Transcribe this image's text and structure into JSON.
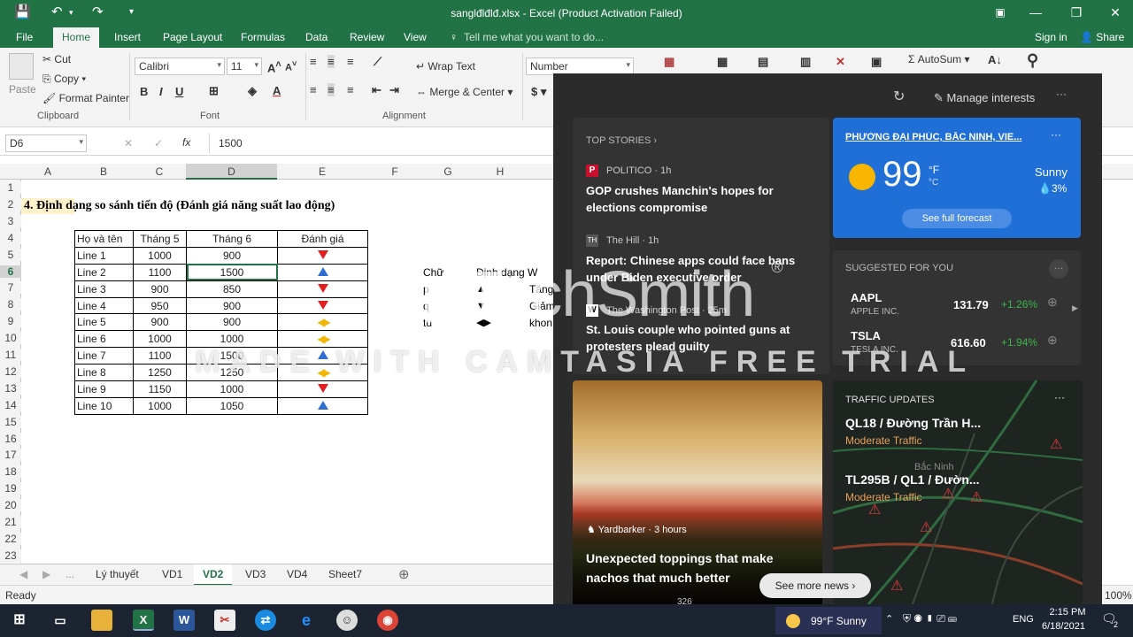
{
  "window": {
    "title": "sanglđlđlđ.xlsx - Excel (Product Activation Failed)"
  },
  "tabs": [
    "File",
    "Home",
    "Insert",
    "Page Layout",
    "Formulas",
    "Data",
    "Review",
    "View"
  ],
  "tell_me": "Tell me what you want to do...",
  "sign_in": "Sign in",
  "share": "Share",
  "clipboard": {
    "paste": "Paste",
    "cut": "Cut",
    "copy": "Copy",
    "format_painter": "Format Painter",
    "group": "Clipboard"
  },
  "font": {
    "name": "Calibri",
    "size": "11",
    "group": "Font"
  },
  "alignment": {
    "wrap_text": "Wrap Text",
    "merge_center": "Merge & Center",
    "group": "Alignment"
  },
  "number": {
    "format": "Number"
  },
  "editing": {
    "autosum": "AutoSum"
  },
  "formula_bar": {
    "name_box": "D6",
    "value": "1500"
  },
  "columns": [
    "A",
    "B",
    "C",
    "D",
    "E",
    "F",
    "G",
    "H"
  ],
  "rows": [
    "1",
    "2",
    "3",
    "4",
    "5",
    "6",
    "7",
    "8",
    "9",
    "10",
    "11",
    "12",
    "13",
    "14",
    "15",
    "16",
    "17",
    "18",
    "19",
    "20",
    "21",
    "22",
    "23"
  ],
  "sheet_title": "4. Định dạng so sánh tiến độ (Đánh giá năng suất lao động)",
  "table": {
    "headers": [
      "Họ và tên",
      "Tháng 5",
      "Tháng 6",
      "Đánh giá"
    ],
    "rows": [
      [
        "Line 1",
        "1000",
        "900",
        "down"
      ],
      [
        "Line 2",
        "1100",
        "1500",
        "up"
      ],
      [
        "Line 3",
        "900",
        "850",
        "down"
      ],
      [
        "Line 4",
        "950",
        "900",
        "down"
      ],
      [
        "Line 5",
        "900",
        "900",
        "same"
      ],
      [
        "Line 6",
        "1000",
        "1000",
        "same"
      ],
      [
        "Line 7",
        "1100",
        "1500",
        "up"
      ],
      [
        "Line 8",
        "1250",
        "1250",
        "same"
      ],
      [
        "Line 9",
        "1150",
        "1000",
        "down"
      ],
      [
        "Line 10",
        "1000",
        "1050",
        "up"
      ]
    ]
  },
  "legend_cells": {
    "g6": "Chữ",
    "h6": "Định dạng W",
    "g7": "p",
    "h7": "Tăng",
    "g8": "q",
    "h8": "Giảm",
    "g9": "tu",
    "h9": "khon"
  },
  "sheet_tabs": [
    "Lý thuyết",
    "VD1",
    "VD2",
    "VD3",
    "VD4",
    "Sheet7"
  ],
  "active_sheet": "VD2",
  "status": {
    "ready": "Ready",
    "zoom": "100%"
  },
  "news": {
    "manage": "Manage interests",
    "top_stories": "TOP STORIES",
    "stories": [
      {
        "source": "POLITICO · 1h",
        "title": "GOP crushes Manchin's hopes for elections compromise"
      },
      {
        "source": "The Hill · 1h",
        "title": "Report: Chinese apps could face bans under Biden executive order"
      },
      {
        "source": "The Washington Post · 25m",
        "title": "St. Louis couple who pointed guns at protesters plead guilty"
      }
    ],
    "weather": {
      "location": "PHƯỜNG ĐẠI PHÚC, BẮC NINH, VIE...",
      "temp": "99",
      "unit_f": "°F",
      "unit_c": "°C",
      "condition": "Sunny",
      "precip": "3%",
      "forecast": "See full forecast"
    },
    "suggested": {
      "title": "SUGGESTED FOR YOU",
      "stocks": [
        {
          "symbol": "AAPL",
          "name": "APPLE INC.",
          "price": "131.79",
          "change": "+1.26%"
        },
        {
          "symbol": "TSLA",
          "name": "TESLA INC.",
          "price": "616.60",
          "change": "+1.94%"
        }
      ]
    },
    "feature": {
      "source": "Yardbarker · 3 hours",
      "title": "Unexpected toppings that make nachos that much better",
      "reactions": "326"
    },
    "traffic": {
      "title": "TRAFFIC UPDATES",
      "routes": [
        {
          "name": "QL18 / Đường Trần H...",
          "status": "Moderate Traffic"
        },
        {
          "name": "TL295B / QL1 / Đườn...",
          "status": "Moderate Traffic"
        }
      ],
      "map_label": "Bắc Ninh"
    },
    "see_more": "See more news"
  },
  "taskbar": {
    "weather": "99°F  Sunny",
    "language": "ENG",
    "time": "2:15 PM",
    "date": "6/18/2021",
    "notifications": "2"
  },
  "watermark": {
    "brand": "TechSmith",
    "text": "MADE WITH CAMTASIA FREE TRIAL"
  },
  "colors": {
    "excel_green": "#217346",
    "weather_blue": "#1f6fd6",
    "traffic_orange": "#e8a25a",
    "down": "#e02020",
    "up": "#2e6fd0",
    "same": "#f2b705"
  }
}
